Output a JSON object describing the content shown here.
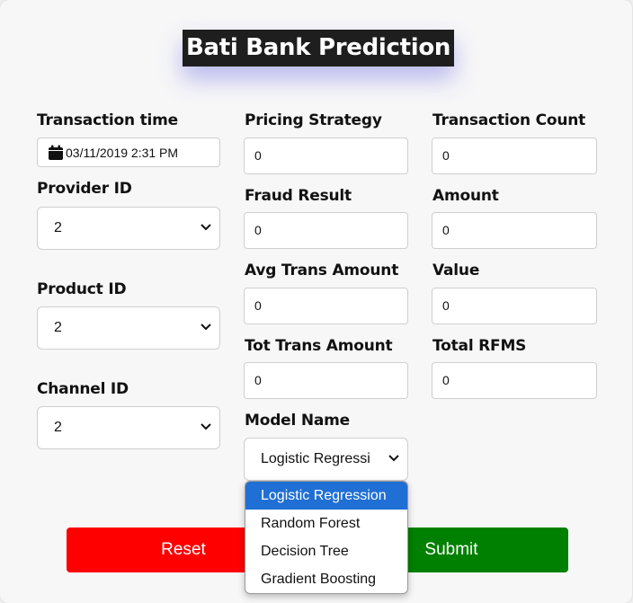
{
  "title": "Bati Bank Prediction",
  "labels": {
    "transaction_time": "Transaction time",
    "pricing_strategy": "Pricing Strategy",
    "transaction_count": "Transaction Count",
    "provider_id": "Provider ID",
    "fraud_result": "Fraud Result",
    "amount": "Amount",
    "avg_trans_amount": "Avg Trans Amount",
    "value": "Value",
    "product_id": "Product ID",
    "tot_trans_amount": "Tot Trans Amount",
    "total_rfms": "Total RFMS",
    "channel_id": "Channel ID",
    "model_name": "Model Name"
  },
  "values": {
    "transaction_time": "03/11/2019 2:31 PM",
    "pricing_strategy": "0",
    "transaction_count": "0",
    "provider_id": "2",
    "fraud_result": "0",
    "amount": "0",
    "avg_trans_amount": "0",
    "value": "0",
    "product_id": "2",
    "tot_trans_amount": "0",
    "total_rfms": "0",
    "channel_id": "2",
    "model_name": "Logistic Regressi"
  },
  "model_options": [
    "Logistic Regression",
    "Random Forest",
    "Decision Tree",
    "Gradient Boosting"
  ],
  "buttons": {
    "reset": "Reset",
    "submit": "Submit"
  },
  "colors": {
    "reset": "#ff0000",
    "submit": "#008000",
    "selected_option": "#1f6fd4",
    "title_bg": "#1e1e1e"
  },
  "icons": {
    "calendar": "calendar-icon",
    "chevron": "chevron-down-icon"
  }
}
